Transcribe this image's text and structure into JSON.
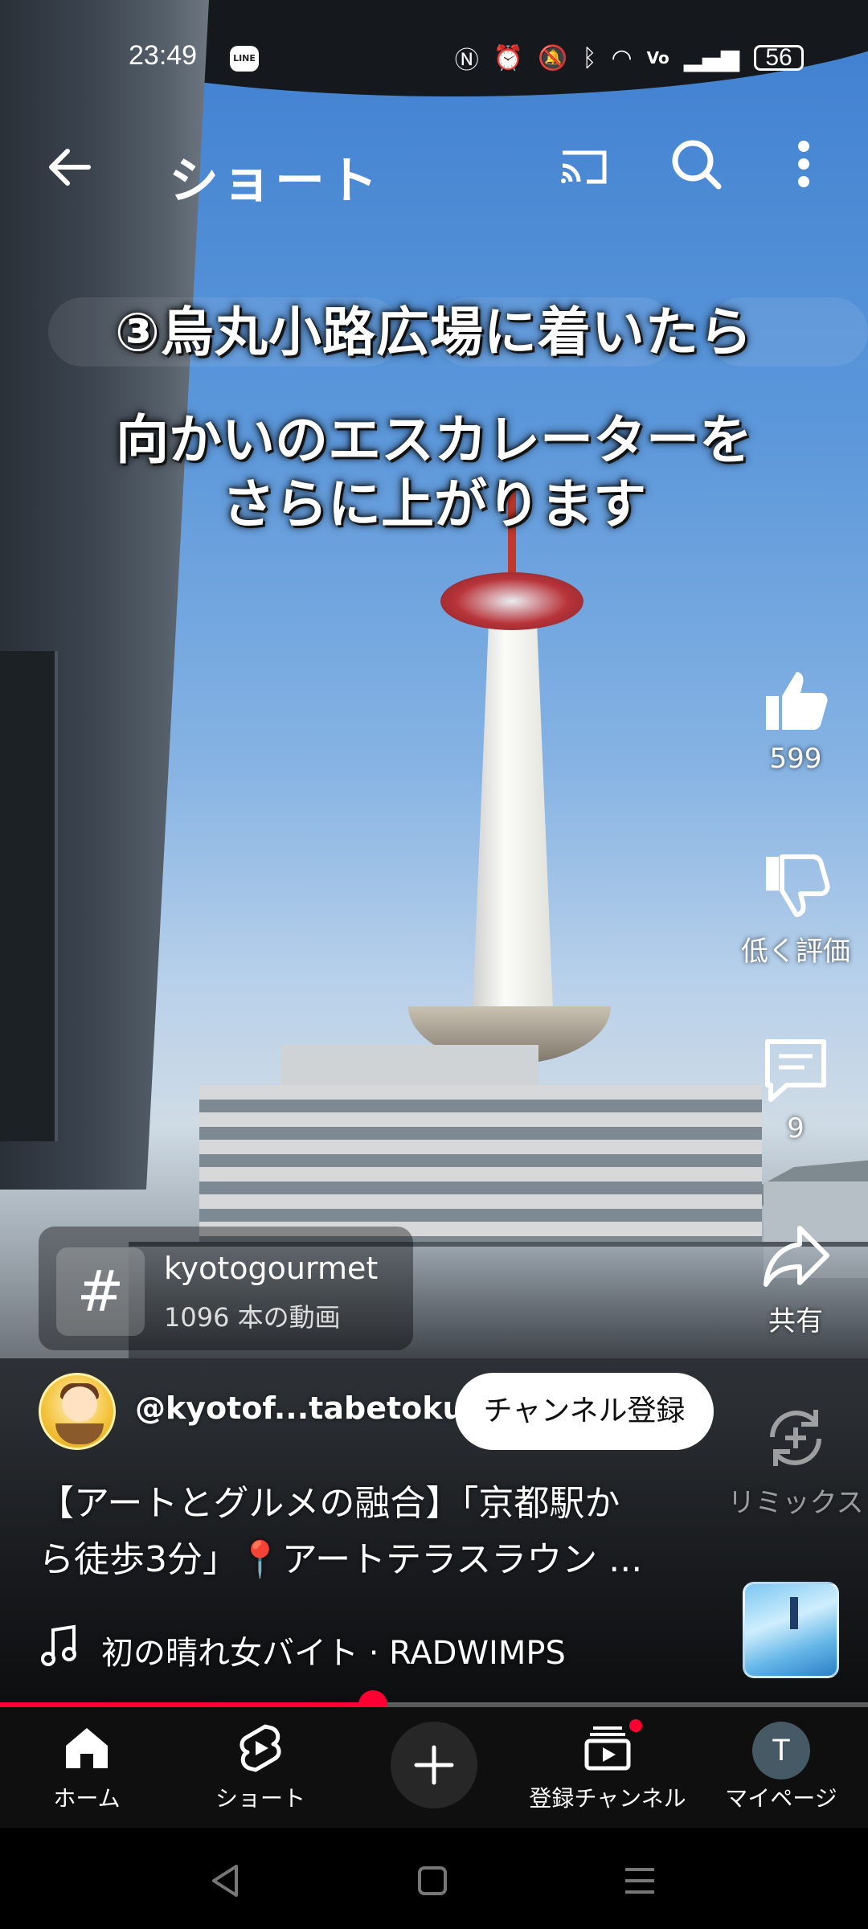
{
  "status_bar": {
    "time": "23:49",
    "line_badge": "LINE",
    "battery": "56"
  },
  "app_bar": {
    "title": "ショート"
  },
  "video": {
    "caption_line1": "③烏丸小路広場に着いたら",
    "caption_line2": "向かいのエスカレーターを",
    "caption_line3": "さらに上がります"
  },
  "rail": {
    "like_count": "599",
    "dislike_label": "低く評価",
    "comment_count": "9",
    "share_label": "共有",
    "remix_label": "リミックス"
  },
  "hashtag": {
    "symbol": "#",
    "name": "kyotogourmet",
    "count": "1096 本の動画"
  },
  "channel": {
    "handle": "@kyotof...tabetoku",
    "subscribe_label": "チャンネル登録"
  },
  "title_lines": [
    "【アートとグルメの融合】「京都駅か",
    "ら徒歩3分」📍アートテラスラウン ..."
  ],
  "music": {
    "text": "初の晴れ女バイト · RADWIMPS"
  },
  "progress": {
    "played_fraction": 0.43
  },
  "bottom_nav": {
    "items": [
      {
        "label": "ホーム"
      },
      {
        "label": "ショート"
      },
      {
        "label": ""
      },
      {
        "label": "登録チャンネル"
      },
      {
        "label": "マイページ"
      }
    ],
    "avatar_letter": "T"
  },
  "colors": {
    "accent": "#ff0033",
    "nav_bg": "#0f0f0f"
  }
}
